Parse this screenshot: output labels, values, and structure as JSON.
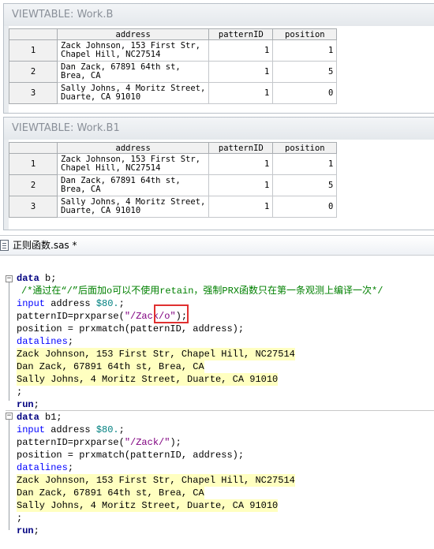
{
  "viewtables": [
    {
      "title": "VIEWTABLE: Work.B",
      "columns": [
        "address",
        "patternID",
        "position"
      ],
      "rows": [
        {
          "n": "1",
          "address": "Zack Johnson, 153 First Str,\nChapel Hill, NC27514",
          "patternID": "1",
          "position": "1"
        },
        {
          "n": "2",
          "address": "Dan Zack, 67891 64th st,\nBrea, CA",
          "patternID": "1",
          "position": "5"
        },
        {
          "n": "3",
          "address": "Sally Johns, 4 Moritz Street,\nDuarte, CA 91010",
          "patternID": "1",
          "position": "0"
        }
      ]
    },
    {
      "title": "VIEWTABLE: Work.B1",
      "columns": [
        "address",
        "patternID",
        "position"
      ],
      "rows": [
        {
          "n": "1",
          "address": "Zack Johnson, 153 First Str,\nChapel Hill, NC27514",
          "patternID": "1",
          "position": "1"
        },
        {
          "n": "2",
          "address": "Dan Zack, 67891 64th st,\nBrea, CA",
          "patternID": "1",
          "position": "5"
        },
        {
          "n": "3",
          "address": "Sally Johns, 4 Moritz Street,\nDuarte, CA 91010",
          "patternID": "1",
          "position": "0"
        }
      ]
    }
  ],
  "editor": {
    "tab_label": "正则函数.sas *",
    "block1": {
      "kw_data": "data",
      "ds": " b;",
      "comment": "/*通过在“/”后面加o可以不使用retain，强制PRX函数只在第一条观测上编译一次*/",
      "input_kw": "input",
      "input_var": " address ",
      "input_fmt": "$80.",
      "input_end": ";",
      "pattern_pre": "patternID=prxparse(",
      "pattern_str": "\"/Zack/o\"",
      "pattern_end": ");",
      "position_line": "position = prxmatch(patternID, address);",
      "datalines_kw": "datalines",
      "datalines_end": ";",
      "data_rows": [
        "Zack Johnson, 153 First Str, Chapel Hill, NC27514",
        "Dan Zack, 67891 64th st, Brea, CA",
        "Sally Johns, 4 Moritz Street, Duarte, CA 91010"
      ],
      "semicolon": ";",
      "run_kw": "run",
      "run_end": ";"
    },
    "block2": {
      "kw_data": "data",
      "ds": " b1;",
      "input_kw": "input",
      "input_var": " address ",
      "input_fmt": "$80.",
      "input_end": ";",
      "pattern_pre": "patternID=prxparse(",
      "pattern_str": "\"/Zack/\"",
      "pattern_end": ");",
      "position_line": "position = prxmatch(patternID, address);",
      "datalines_kw": "datalines",
      "datalines_end": ";",
      "data_rows": [
        "Zack Johnson, 153 First Str, Chapel Hill, NC27514",
        "Dan Zack, 67891 64th st, Brea, CA",
        "Sally Johns, 4 Moritz Street, Duarte, CA 91010"
      ],
      "semicolon": ";",
      "run_kw": "run",
      "run_end": ";"
    }
  },
  "colors": {
    "keyword": "#000080",
    "statement": "#0000ff",
    "comment": "#008000",
    "string": "#800080",
    "format": "#008080",
    "datalines_bg": "#ffffc0",
    "highlight_box": "#e03030"
  },
  "icons": {
    "tab_icon": "sas-program-file-icon"
  }
}
